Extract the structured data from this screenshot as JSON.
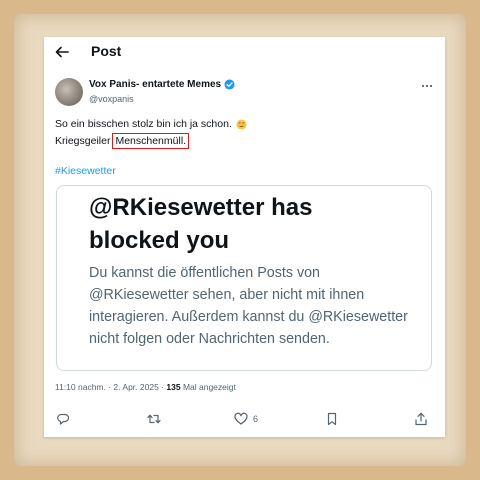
{
  "header": {
    "title": "Post"
  },
  "author": {
    "name": "Vox Panis- entartete Memes",
    "handle": "@voxpanis"
  },
  "post": {
    "line1": "So ein bisschen stolz bin ich ja schon.",
    "line2_prefix": "Kriegsgeiler",
    "line2_highlight": "Menschenmüll.",
    "hashtag": "#Kiesewetter"
  },
  "embed": {
    "title": "@RKiesewetter has blocked you",
    "body": "Du kannst die öffentlichen Posts von @RKiesewetter sehen, aber nicht mit ihnen interagieren. Außerdem kannst du @RKiesewetter nicht folgen oder Nachrichten senden."
  },
  "meta": {
    "time_date": "11:10 nachm. · 2. Apr. 2025 ·",
    "views": "135",
    "views_label": "Mal angezeigt"
  },
  "actions": {
    "likes": "6"
  },
  "icons": [
    "back-arrow-icon",
    "verified-badge-icon",
    "more-icon",
    "smiling-face-icon",
    "reply-icon",
    "repost-icon",
    "like-icon",
    "bookmark-icon",
    "share-icon"
  ],
  "colors": {
    "accent": "#1d9bf0",
    "highlight_box": "#e01818",
    "paper": "#e9d9bf",
    "cardboard": "#d9b98c"
  }
}
